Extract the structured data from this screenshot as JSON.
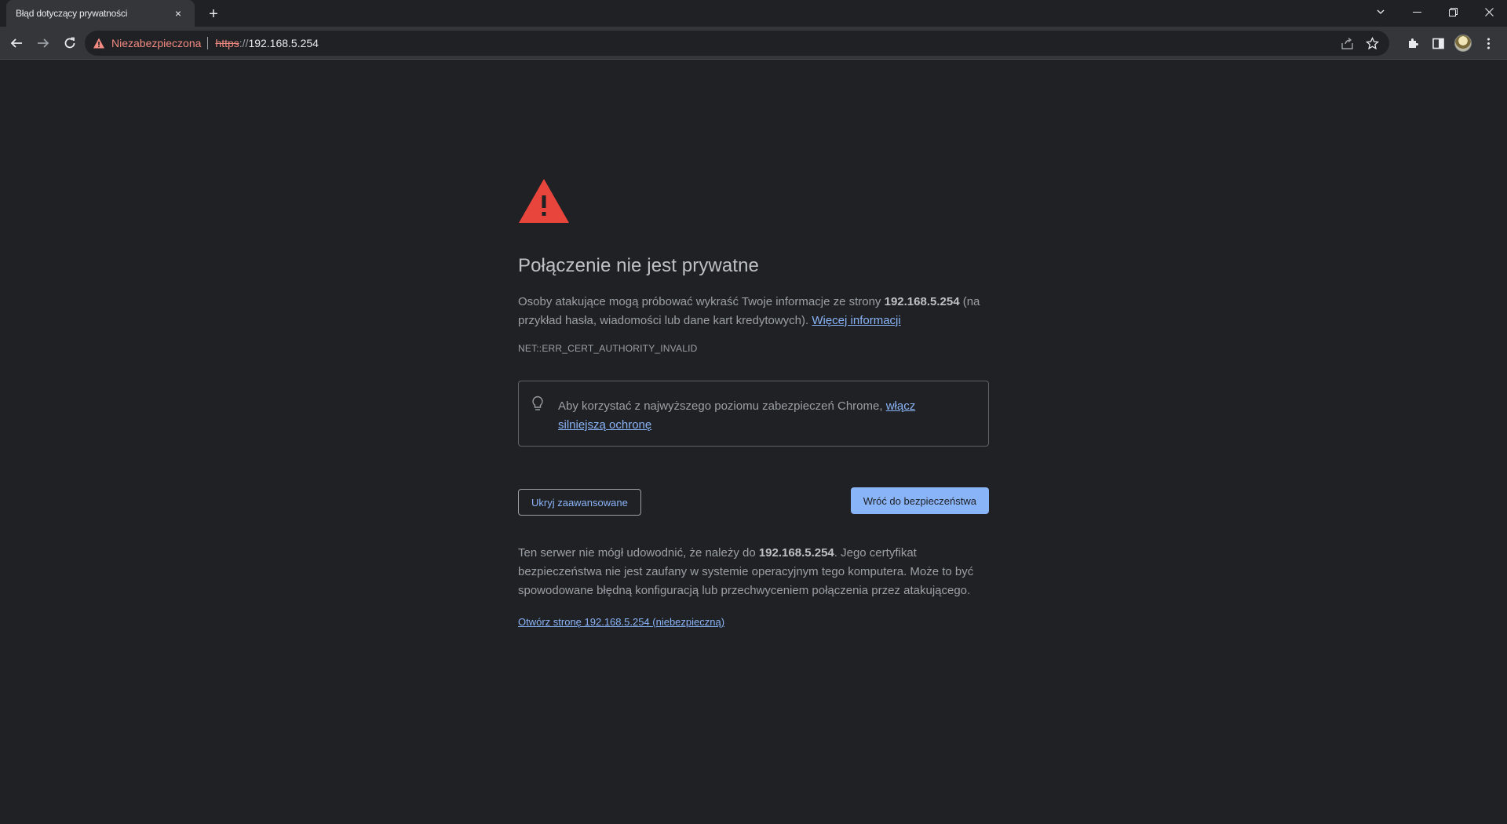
{
  "window": {
    "tab_title": "Błąd dotyczący prywatności",
    "tab_close": "×",
    "new_tab": "+",
    "controls": {
      "dropdown": "⌄",
      "minimize": "—",
      "restore": "❐",
      "close": "✕"
    }
  },
  "toolbar": {
    "security_label": "Niezabezpieczona",
    "url_scheme": "https",
    "url_sep": "://",
    "url_host": "192.168.5.254"
  },
  "icons": {
    "back": "arrow-left-icon",
    "forward": "arrow-right-icon",
    "reload": "reload-icon",
    "warning": "warning-triangle-icon",
    "share": "share-icon",
    "bookmark": "star-icon",
    "extensions": "puzzle-icon",
    "side_panel": "side-panel-icon",
    "menu": "kebab-menu-icon",
    "bulb": "lightbulb-icon"
  },
  "colors": {
    "background": "#202124",
    "toolbar": "#35363a",
    "danger": "#f28b82",
    "warning_triangle": "#e8453c",
    "link": "#8ab4f8"
  },
  "interstitial": {
    "heading": "Połączenie nie jest prywatne",
    "main_msg_before": "Osoby atakujące mogą próbować wykraść Twoje informacje ze strony ",
    "main_msg_host": "192.168.5.254",
    "main_msg_after": " (na przykład hasła, wiadomości lub dane kart kredytowych). ",
    "learn_more": "Więcej informacji",
    "error_code": "NET::ERR_CERT_AUTHORITY_INVALID",
    "enhanced_before": "Aby korzystać z najwyższego poziomu zabezpieczeń Chrome, ",
    "enhanced_link": "włącz silniejszą ochronę",
    "hide_advanced": "Ukryj zaawansowane",
    "back_to_safety": "Wróć do bezpieczeństwa",
    "details_before": "Ten serwer nie mógł udowodnić, że należy do ",
    "details_host": "192.168.5.254",
    "details_after": ". Jego certyfikat bezpieczeństwa nie jest zaufany w systemie operacyjnym tego komputera. Może to być spowodowane błędną konfiguracją lub przechwyceniem połączenia przez atakującego.",
    "proceed_link": "Otwórz stronę 192.168.5.254 (niebezpieczną)"
  }
}
